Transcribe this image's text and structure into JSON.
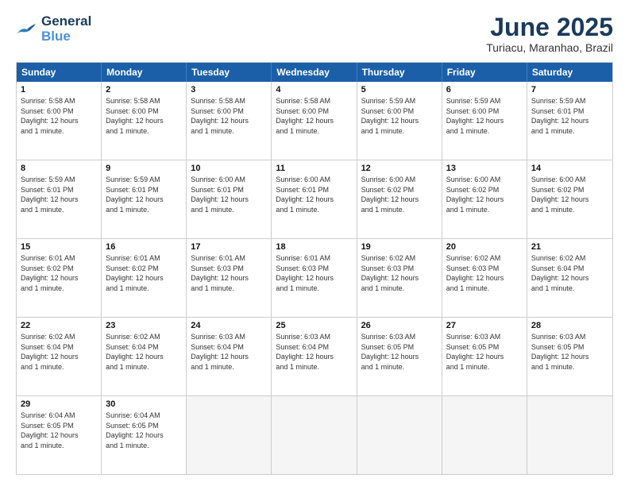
{
  "logo": {
    "line1": "General",
    "line2": "Blue"
  },
  "title": "June 2025",
  "subtitle": "Turiacu, Maranhao, Brazil",
  "header_days": [
    "Sunday",
    "Monday",
    "Tuesday",
    "Wednesday",
    "Thursday",
    "Friday",
    "Saturday"
  ],
  "weeks": [
    [
      {
        "day": "1",
        "lines": [
          "Sunrise: 5:58 AM",
          "Sunset: 6:00 PM",
          "Daylight: 12 hours",
          "and 1 minute."
        ]
      },
      {
        "day": "2",
        "lines": [
          "Sunrise: 5:58 AM",
          "Sunset: 6:00 PM",
          "Daylight: 12 hours",
          "and 1 minute."
        ]
      },
      {
        "day": "3",
        "lines": [
          "Sunrise: 5:58 AM",
          "Sunset: 6:00 PM",
          "Daylight: 12 hours",
          "and 1 minute."
        ]
      },
      {
        "day": "4",
        "lines": [
          "Sunrise: 5:58 AM",
          "Sunset: 6:00 PM",
          "Daylight: 12 hours",
          "and 1 minute."
        ]
      },
      {
        "day": "5",
        "lines": [
          "Sunrise: 5:59 AM",
          "Sunset: 6:00 PM",
          "Daylight: 12 hours",
          "and 1 minute."
        ]
      },
      {
        "day": "6",
        "lines": [
          "Sunrise: 5:59 AM",
          "Sunset: 6:00 PM",
          "Daylight: 12 hours",
          "and 1 minute."
        ]
      },
      {
        "day": "7",
        "lines": [
          "Sunrise: 5:59 AM",
          "Sunset: 6:01 PM",
          "Daylight: 12 hours",
          "and 1 minute."
        ]
      }
    ],
    [
      {
        "day": "8",
        "lines": [
          "Sunrise: 5:59 AM",
          "Sunset: 6:01 PM",
          "Daylight: 12 hours",
          "and 1 minute."
        ]
      },
      {
        "day": "9",
        "lines": [
          "Sunrise: 5:59 AM",
          "Sunset: 6:01 PM",
          "Daylight: 12 hours",
          "and 1 minute."
        ]
      },
      {
        "day": "10",
        "lines": [
          "Sunrise: 6:00 AM",
          "Sunset: 6:01 PM",
          "Daylight: 12 hours",
          "and 1 minute."
        ]
      },
      {
        "day": "11",
        "lines": [
          "Sunrise: 6:00 AM",
          "Sunset: 6:01 PM",
          "Daylight: 12 hours",
          "and 1 minute."
        ]
      },
      {
        "day": "12",
        "lines": [
          "Sunrise: 6:00 AM",
          "Sunset: 6:02 PM",
          "Daylight: 12 hours",
          "and 1 minute."
        ]
      },
      {
        "day": "13",
        "lines": [
          "Sunrise: 6:00 AM",
          "Sunset: 6:02 PM",
          "Daylight: 12 hours",
          "and 1 minute."
        ]
      },
      {
        "day": "14",
        "lines": [
          "Sunrise: 6:00 AM",
          "Sunset: 6:02 PM",
          "Daylight: 12 hours",
          "and 1 minute."
        ]
      }
    ],
    [
      {
        "day": "15",
        "lines": [
          "Sunrise: 6:01 AM",
          "Sunset: 6:02 PM",
          "Daylight: 12 hours",
          "and 1 minute."
        ]
      },
      {
        "day": "16",
        "lines": [
          "Sunrise: 6:01 AM",
          "Sunset: 6:02 PM",
          "Daylight: 12 hours",
          "and 1 minute."
        ]
      },
      {
        "day": "17",
        "lines": [
          "Sunrise: 6:01 AM",
          "Sunset: 6:03 PM",
          "Daylight: 12 hours",
          "and 1 minute."
        ]
      },
      {
        "day": "18",
        "lines": [
          "Sunrise: 6:01 AM",
          "Sunset: 6:03 PM",
          "Daylight: 12 hours",
          "and 1 minute."
        ]
      },
      {
        "day": "19",
        "lines": [
          "Sunrise: 6:02 AM",
          "Sunset: 6:03 PM",
          "Daylight: 12 hours",
          "and 1 minute."
        ]
      },
      {
        "day": "20",
        "lines": [
          "Sunrise: 6:02 AM",
          "Sunset: 6:03 PM",
          "Daylight: 12 hours",
          "and 1 minute."
        ]
      },
      {
        "day": "21",
        "lines": [
          "Sunrise: 6:02 AM",
          "Sunset: 6:04 PM",
          "Daylight: 12 hours",
          "and 1 minute."
        ]
      }
    ],
    [
      {
        "day": "22",
        "lines": [
          "Sunrise: 6:02 AM",
          "Sunset: 6:04 PM",
          "Daylight: 12 hours",
          "and 1 minute."
        ]
      },
      {
        "day": "23",
        "lines": [
          "Sunrise: 6:02 AM",
          "Sunset: 6:04 PM",
          "Daylight: 12 hours",
          "and 1 minute."
        ]
      },
      {
        "day": "24",
        "lines": [
          "Sunrise: 6:03 AM",
          "Sunset: 6:04 PM",
          "Daylight: 12 hours",
          "and 1 minute."
        ]
      },
      {
        "day": "25",
        "lines": [
          "Sunrise: 6:03 AM",
          "Sunset: 6:04 PM",
          "Daylight: 12 hours",
          "and 1 minute."
        ]
      },
      {
        "day": "26",
        "lines": [
          "Sunrise: 6:03 AM",
          "Sunset: 6:05 PM",
          "Daylight: 12 hours",
          "and 1 minute."
        ]
      },
      {
        "day": "27",
        "lines": [
          "Sunrise: 6:03 AM",
          "Sunset: 6:05 PM",
          "Daylight: 12 hours",
          "and 1 minute."
        ]
      },
      {
        "day": "28",
        "lines": [
          "Sunrise: 6:03 AM",
          "Sunset: 6:05 PM",
          "Daylight: 12 hours",
          "and 1 minute."
        ]
      }
    ],
    [
      {
        "day": "29",
        "lines": [
          "Sunrise: 6:04 AM",
          "Sunset: 6:05 PM",
          "Daylight: 12 hours",
          "and 1 minute."
        ]
      },
      {
        "day": "30",
        "lines": [
          "Sunrise: 6:04 AM",
          "Sunset: 6:05 PM",
          "Daylight: 12 hours",
          "and 1 minute."
        ]
      },
      {
        "day": "",
        "lines": []
      },
      {
        "day": "",
        "lines": []
      },
      {
        "day": "",
        "lines": []
      },
      {
        "day": "",
        "lines": []
      },
      {
        "day": "",
        "lines": []
      }
    ]
  ]
}
